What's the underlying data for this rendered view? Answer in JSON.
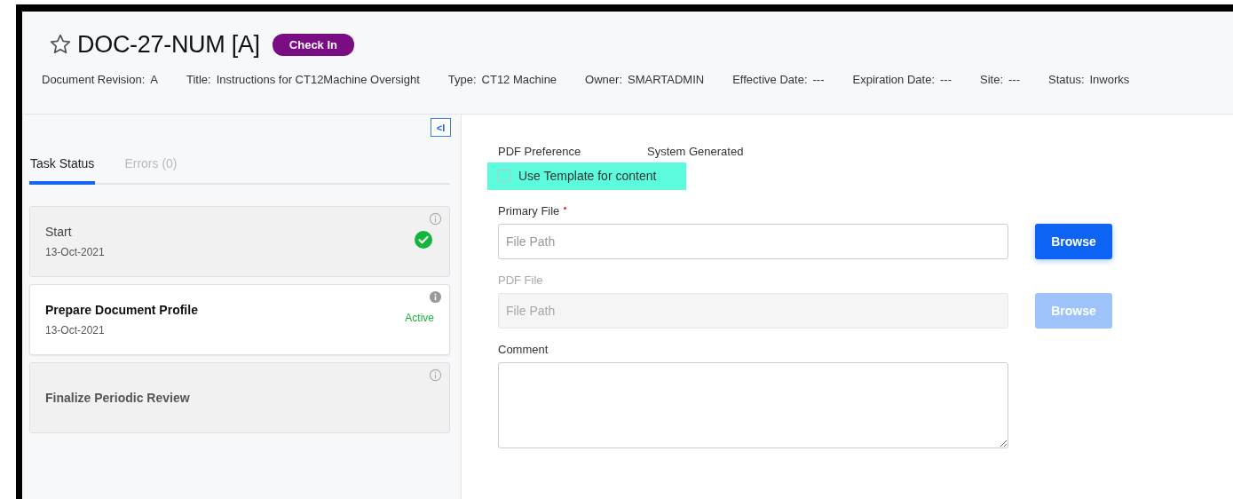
{
  "header": {
    "title": "DOC-27-NUM [A]",
    "starred": false,
    "action_badge": "Check In",
    "meta": [
      {
        "label": "Document Revision:",
        "value": "A"
      },
      {
        "label": "Title:",
        "value": "Instructions for CT12Machine Oversight"
      },
      {
        "label": "Type:",
        "value": "CT12 Machine"
      },
      {
        "label": "Owner:",
        "value": "SMARTADMIN"
      },
      {
        "label": "Effective Date:",
        "value": "---"
      },
      {
        "label": "Expiration Date:",
        "value": "---"
      },
      {
        "label": "Site:",
        "value": "---"
      },
      {
        "label": "Status:",
        "value": "Inworks"
      }
    ]
  },
  "sidebar": {
    "collapse_button": "<I",
    "tabs": [
      {
        "label": "Task Status",
        "selected": true
      },
      {
        "label": "Errors (0)",
        "selected": false
      }
    ],
    "tasks": [
      {
        "name": "Start",
        "date": "13-Oct-2021",
        "kind": "done"
      },
      {
        "name": "Prepare Document Profile",
        "date": "13-Oct-2021",
        "kind": "active",
        "status": "Active"
      },
      {
        "name": "Finalize Periodic Review",
        "kind": "pending"
      }
    ]
  },
  "form": {
    "pdf_preference": {
      "label": "PDF Preference",
      "value": "System Generated"
    },
    "template_checkbox": {
      "label": "Use Template for content",
      "checked": false,
      "highlighted": true
    },
    "files": [
      {
        "label": "Primary File",
        "required": true,
        "placeholder": "File Path",
        "button": "Browse",
        "disabled": false
      },
      {
        "label": "PDF File",
        "required": false,
        "placeholder": "File Path",
        "button": "Browse",
        "disabled": true
      }
    ],
    "comment": {
      "label": "Comment"
    }
  }
}
